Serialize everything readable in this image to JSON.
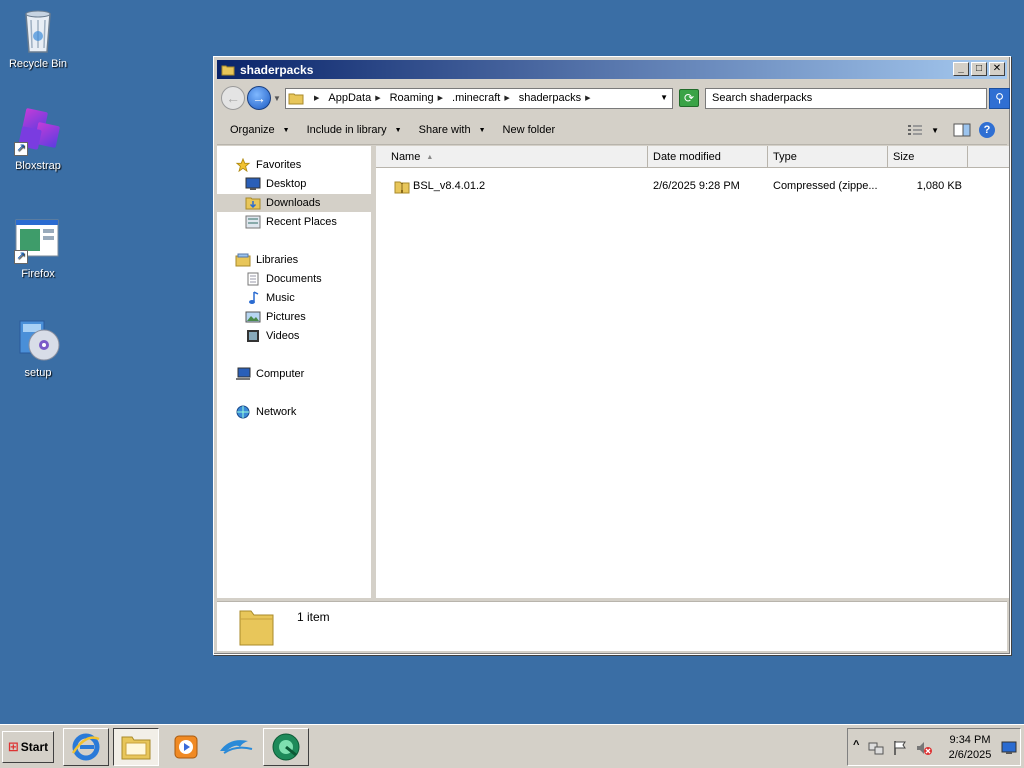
{
  "desktop": {
    "icons": [
      {
        "label": "Recycle Bin",
        "icon": "recycle-bin-icon"
      },
      {
        "label": "Bloxstrap",
        "icon": "bloxstrap-icon"
      },
      {
        "label": "Firefox",
        "icon": "firefox-icon"
      },
      {
        "label": "setup",
        "icon": "setup-icon"
      }
    ]
  },
  "window": {
    "title": "shaderpacks",
    "buttons": {
      "minimize": "_",
      "maximize": "□",
      "close": "✕"
    },
    "address": {
      "crumbs": [
        "AppData",
        "Roaming",
        ".minecraft",
        "shaderpacks"
      ]
    },
    "search": {
      "placeholder": "Search shaderpacks"
    },
    "toolbar": {
      "organize": "Organize",
      "include": "Include in library",
      "share": "Share with",
      "new_folder": "New folder"
    },
    "nav": {
      "favorites": "Favorites",
      "desktop": "Desktop",
      "downloads": "Downloads",
      "recent": "Recent Places",
      "libraries": "Libraries",
      "documents": "Documents",
      "music": "Music",
      "pictures": "Pictures",
      "videos": "Videos",
      "computer": "Computer",
      "network": "Network"
    },
    "columns": {
      "name": "Name",
      "date": "Date modified",
      "type": "Type",
      "size": "Size"
    },
    "files": [
      {
        "name": "BSL_v8.4.01.2",
        "date": "2/6/2025 9:28 PM",
        "type": "Compressed (zippe...",
        "size": "1,080 KB"
      }
    ],
    "details": {
      "count": "1 item"
    }
  },
  "taskbar": {
    "start": "Start",
    "clock": {
      "time": "9:34 PM",
      "date": "2/6/2025"
    },
    "tray_expand": "^"
  },
  "colors": {
    "desktop": "#3a6ea5",
    "title_start": "#0a246a",
    "title_end": "#a6caf0",
    "chrome": "#d4d0c8",
    "folder": "#e8c65a"
  }
}
